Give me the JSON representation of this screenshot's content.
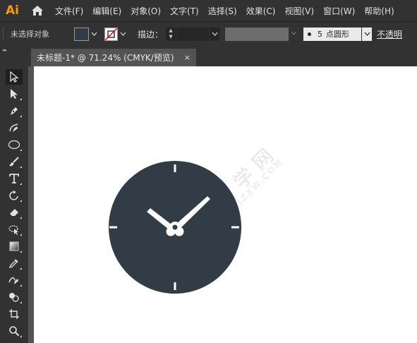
{
  "app": {
    "logo": "Ai",
    "accent": "#ff9a00"
  },
  "menu": [
    "文件(F)",
    "编辑(E)",
    "对象(O)",
    "文字(T)",
    "选择(S)",
    "效果(C)",
    "视图(V)",
    "窗口(W)",
    "帮助(H)"
  ],
  "control": {
    "selection_status": "未选择对象",
    "fill_color": "#313c46",
    "stroke_label": "描边：",
    "brush_size": "5",
    "brush_name": "点圆形",
    "opacity_label": "不透明"
  },
  "tab": {
    "title": "未标题-1* @ 71.24% (CMYK/预览)",
    "close": "×"
  },
  "tools": [
    "selection-arrow-icon",
    "direct-selection-icon",
    "pen-icon",
    "curvature-icon",
    "ellipse-icon",
    "paintbrush-icon",
    "type-icon",
    "rotate-icon",
    "eraser-icon",
    "lasso-icon",
    "gradient-icon",
    "eyedropper-icon",
    "blend-icon",
    "shape-builder-icon",
    "artboard-icon",
    "zoom-icon"
  ],
  "watermark": {
    "main": "软件自学网",
    "sub": "WWW.RJZXW.COM"
  },
  "clock": {
    "face_color": "#313c46",
    "hand_color": "#ffffff"
  }
}
